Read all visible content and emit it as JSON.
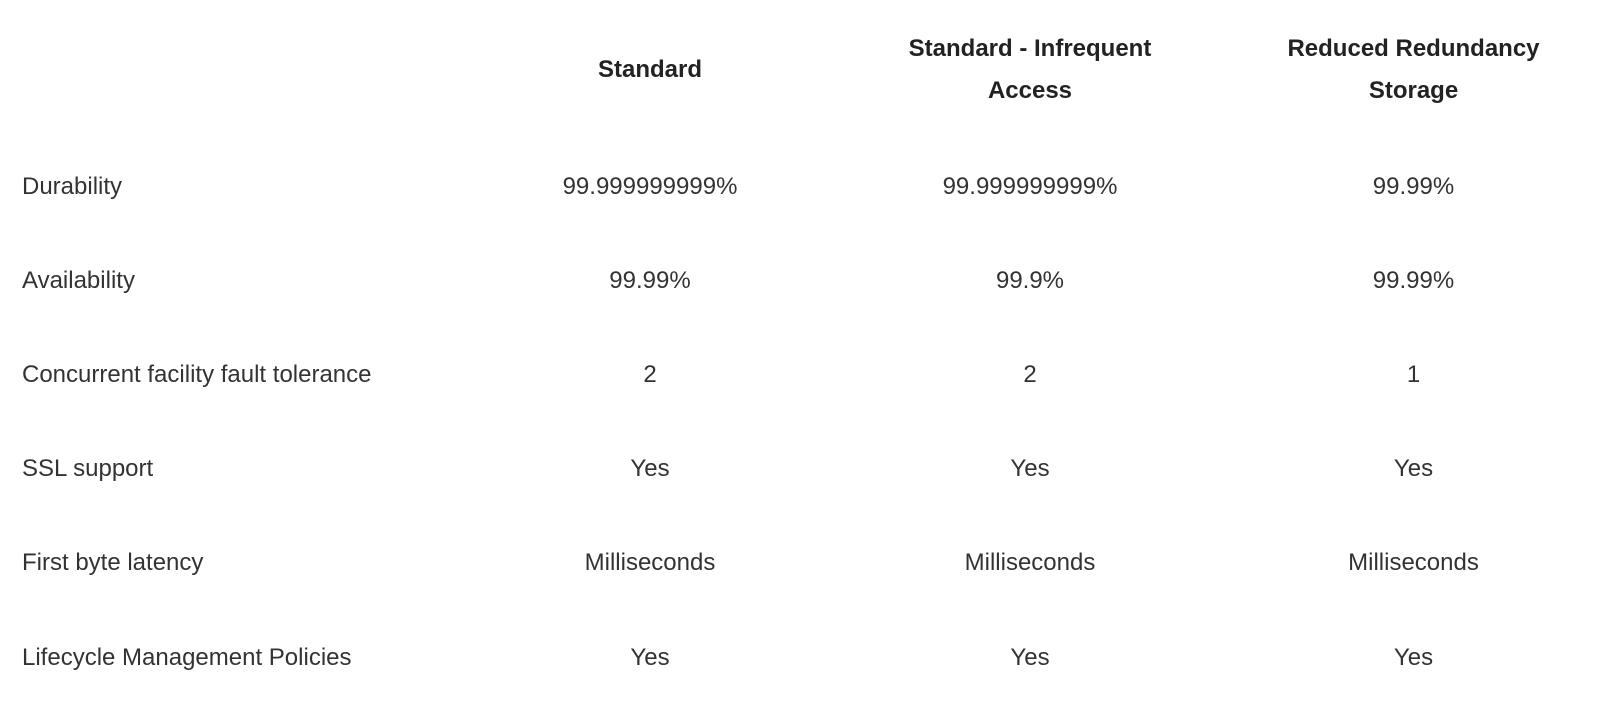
{
  "table": {
    "columns": [
      "",
      "Standard",
      "Standard - Infrequent Access",
      "Reduced Redundancy Storage"
    ],
    "rows": [
      {
        "label": "Durability",
        "values": [
          "99.999999999%",
          "99.999999999%",
          "99.99%"
        ]
      },
      {
        "label": "Availability",
        "values": [
          "99.99%",
          "99.9%",
          "99.99%"
        ]
      },
      {
        "label": "Concurrent facility fault tolerance",
        "values": [
          "2",
          "2",
          "1"
        ]
      },
      {
        "label": "SSL support",
        "values": [
          "Yes",
          "Yes",
          "Yes"
        ]
      },
      {
        "label": "First byte latency",
        "values": [
          "Milliseconds",
          "Milliseconds",
          "Milliseconds"
        ]
      },
      {
        "label": "Lifecycle Management Policies",
        "values": [
          "Yes",
          "Yes",
          "Yes"
        ]
      }
    ]
  }
}
